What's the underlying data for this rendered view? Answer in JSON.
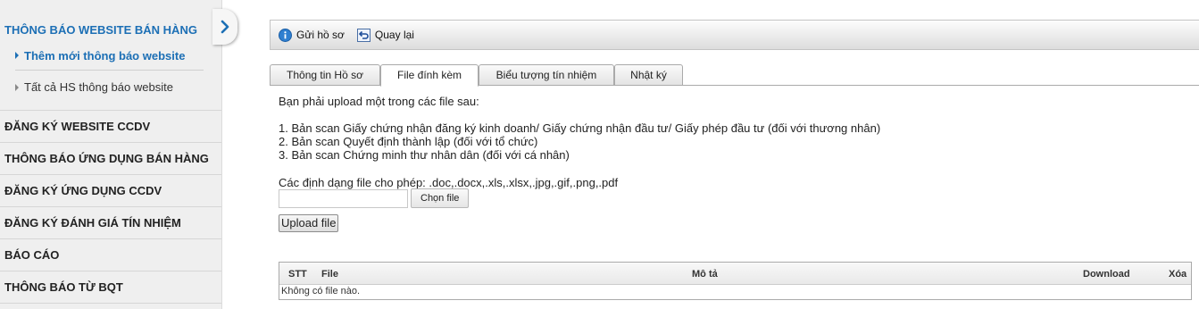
{
  "sidebar": {
    "active_section": "THÔNG BÁO WEBSITE BÁN HÀNG",
    "sub_items": [
      "Thêm mới thông báo website",
      "Tất cả HS thông báo website"
    ],
    "items": [
      "ĐĂNG KÝ WEBSITE CCDV",
      "THÔNG BÁO ỨNG DỤNG BÁN HÀNG",
      "ĐĂNG KÝ ỨNG DỤNG CCDV",
      "ĐĂNG KÝ ĐÁNH GIÁ TÍN NHIỆM",
      "BÁO CÁO",
      "THÔNG BÁO TỪ BQT"
    ]
  },
  "toolbar": {
    "submit_label": "Gửi hồ sơ",
    "back_label": "Quay lại"
  },
  "tabs": [
    "Thông tin Hồ sơ",
    "File đính kèm",
    "Biểu tượng tín nhiệm",
    "Nhật ký"
  ],
  "active_tab": "File đính kèm",
  "content": {
    "intro": "Bạn phải upload một trong các file sau:",
    "files": [
      "1. Bản scan Giấy chứng nhận đăng ký kinh doanh/ Giấy chứng nhận đầu tư/ Giấy phép đầu tư (đối với thương nhân)",
      "2. Bản scan Quyết định thành lập (đối với tổ chức)",
      "3. Bản scan Chứng minh thư nhân dân (đối với cá nhân)"
    ],
    "formats": "Các định dạng file cho phép: .doc,.docx,.xls,.xlsx,.jpg,.gif,.png,.pdf",
    "choose_label": "Chọn file",
    "upload_label": "Upload file"
  },
  "table": {
    "columns": [
      "STT",
      "File",
      "Mô tả",
      "Download",
      "Xóa"
    ],
    "empty_text": "Không có file nào."
  }
}
